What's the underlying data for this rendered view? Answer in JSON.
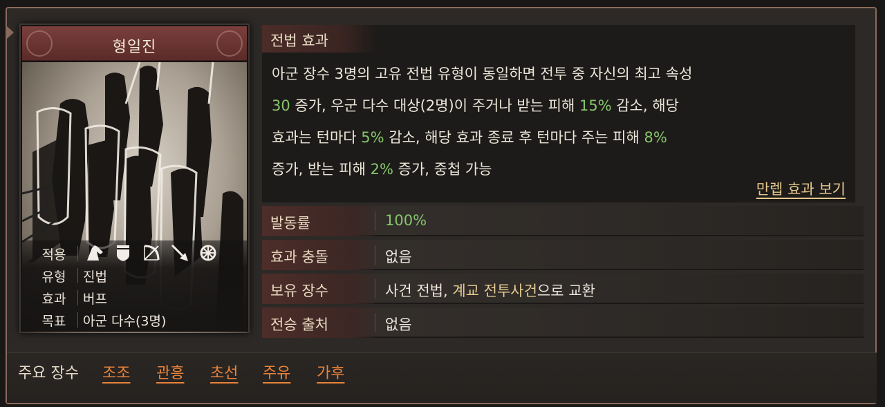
{
  "card": {
    "title": "형일진",
    "rows": [
      {
        "key": "적용",
        "icons": [
          "cavalry-icon",
          "shield-icon",
          "bow-icon",
          "spear-icon",
          "wheel-icon"
        ]
      },
      {
        "key": "유형",
        "value": "진법"
      },
      {
        "key": "효과",
        "value": "버프"
      },
      {
        "key": "목표",
        "value": "아군 다수(3명)"
      }
    ]
  },
  "effect": {
    "heading": "전법 효과",
    "line1": "아군 장수 3명의 고유 전법 유형이 동일하면 전투 중 자신의 최고 속성",
    "l2_v1": "30",
    "l2_t1": " 증가, 우군 다수 대상(2명)이 주거나 받는 피해 ",
    "l2_v2": "15%",
    "l2_t2": " 감소, 해당",
    "l3_t1": "효과는 턴마다 ",
    "l3_v1": "5%",
    "l3_t2": " 감소, 해당 효과 종료 후 턴마다 주는 피해 ",
    "l3_v2": "8%",
    "l4_t1": "증가, 받는 피해 ",
    "l4_v1": "2%",
    "l4_t2": " 증가, 중첩 가능",
    "more_link": "만렙 효과 보기"
  },
  "stats": {
    "activation_label": "발동률",
    "activation_value": "100%",
    "conflict_label": "효과 충돌",
    "conflict_value": "없음",
    "owner_label": "보유 장수",
    "owner_prefix": "사건 전법, ",
    "owner_highlight": "계교 전투사건",
    "owner_suffix": "으로 교환",
    "inherit_label": "전승 출처",
    "inherit_value": "없음"
  },
  "bottom": {
    "label": "주요 장수",
    "generals": [
      "조조",
      "관흥",
      "초선",
      "주유",
      "가후"
    ]
  },
  "colors": {
    "highlight_green": "#86c56b",
    "link_gold": "#e5c88e",
    "link_orange": "#e9833a",
    "title_bar": "#6a3533"
  }
}
